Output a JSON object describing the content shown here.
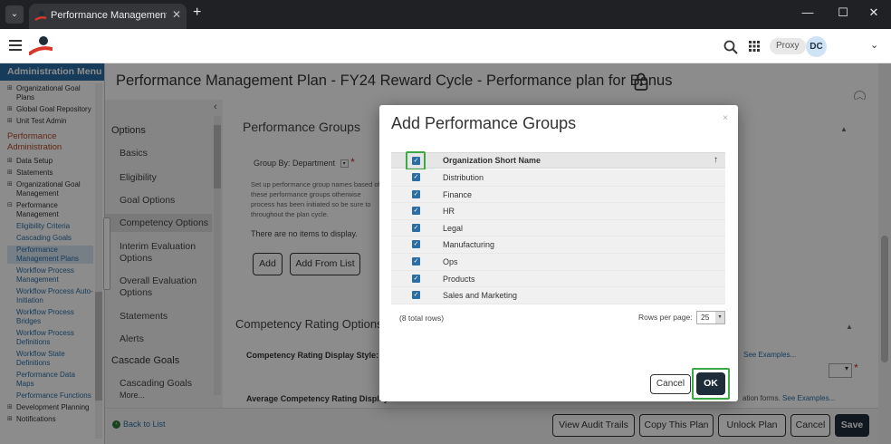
{
  "browser": {
    "tab_title": "Performance Management Plan",
    "new_tab": "+",
    "minimize": "—",
    "maximize": "☐",
    "close": "✕"
  },
  "appbar": {
    "proxy_label": "Proxy",
    "avatar_initials": "DC"
  },
  "admin_menu": {
    "header": "Administration Menu",
    "items_top": [
      {
        "expander": "⊞",
        "label": "Organizational Goal Plans"
      },
      {
        "expander": "⊞",
        "label": "Global Goal Repository"
      },
      {
        "expander": "⊞",
        "label": "Unit Test Admin"
      }
    ],
    "section_title": "Performance Administration",
    "items": [
      {
        "expander": "⊞",
        "label": "Data Setup"
      },
      {
        "expander": "⊞",
        "label": "Statements"
      },
      {
        "expander": "⊞",
        "label": "Organizational Goal Management"
      },
      {
        "expander": "⊟",
        "label": "Performance Management"
      }
    ],
    "sub_items": [
      "Eligibility Criteria",
      "Cascading Goals",
      "Performance Management Plans",
      "Workflow Process Management",
      "Workflow Process Auto-Initiation",
      "Workflow Process Bridges",
      "Workflow Process Definitions",
      "Workflow State Definitions",
      "Performance Data Maps",
      "Performance Functions"
    ],
    "items_bottom": [
      {
        "expander": "⊞",
        "label": "Development Planning"
      },
      {
        "expander": "⊞",
        "label": "Notifications"
      }
    ]
  },
  "page": {
    "title": "Performance Management Plan - FY24 Reward Cycle - Performance plan for Bonus"
  },
  "options_panel": {
    "title": "Options",
    "items": [
      "Basics",
      "Eligibility",
      "Goal Options",
      "Competency Options",
      "Interim Evaluation Options",
      "Overall Evaluation Options",
      "Statements",
      "Alerts"
    ],
    "cascade_title": "Cascade Goals",
    "cascade_items": [
      "Cascading Goals",
      "More..."
    ]
  },
  "performance_groups": {
    "header": "Performance Groups",
    "group_by_label": "Group By:",
    "group_by_value": "Department",
    "description": "Set up performance group names based of these performance groups otherwise process has been initiated so be sure to throughout the plan cycle.",
    "no_items": "There are no items to display.",
    "add_button": "Add",
    "add_from_list_button": "Add From List"
  },
  "competency": {
    "header": "Competency Rating Options",
    "display_style_label": "Competency Rating Display Style:",
    "see_examples": "See Examples...",
    "avg_label": "Average Competency Rating Display F",
    "avg_suffix": "ation forms.",
    "see_examples2": "See Examples..."
  },
  "footer": {
    "back_link": "Back to List",
    "buttons": [
      "View Audit Trails",
      "Copy This Plan",
      "Unlock Plan",
      "Cancel",
      "Save"
    ]
  },
  "modal": {
    "title": "Add Performance Groups",
    "close": "×",
    "column_header": "Organization Short Name",
    "sort_icon": "↑",
    "rows": [
      "Distribution",
      "Finance",
      "HR",
      "Legal",
      "Manufacturing",
      "Ops",
      "Products",
      "Sales and Marketing"
    ],
    "total_rows": "(8 total rows)",
    "rows_per_page_label": "Rows per page:",
    "rows_per_page_value": "25",
    "cancel_button": "Cancel",
    "ok_button": "OK"
  },
  "colors": {
    "brand_blue": "#2b6ea6",
    "primary_button": "#1f2d3a",
    "highlight_green": "#39a845",
    "section_accent": "#b5472a"
  }
}
